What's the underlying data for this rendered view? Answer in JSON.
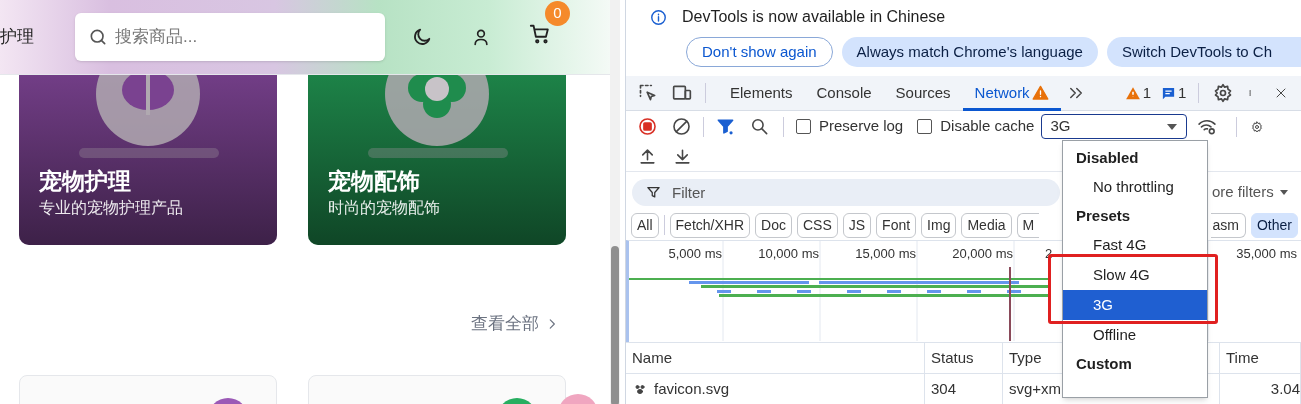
{
  "page": {
    "nav_fragment": "护理",
    "search": {
      "placeholder": "搜索商品..."
    },
    "cart_count": "0",
    "categories": [
      {
        "title": "宠物护理",
        "subtitle": "专业的宠物护理产品",
        "color": "#7a4290"
      },
      {
        "title": "宠物配饰",
        "subtitle": "时尚的宠物配饰",
        "color": "#1f8c4d"
      }
    ],
    "view_all": "查看全部",
    "product_cards": [
      {
        "color": "#9b59b6"
      },
      {
        "color": "#27ae60"
      }
    ]
  },
  "devtools": {
    "infobar": {
      "message": "DevTools is now available in Chinese",
      "buttons": [
        {
          "label": "Don't show again",
          "kind": "outline"
        },
        {
          "label": "Always match Chrome's language",
          "kind": "filled"
        },
        {
          "label": "Switch DevTools to Ch",
          "kind": "filled"
        }
      ]
    },
    "tabs": [
      {
        "label": "Elements",
        "selected": false,
        "warning": false
      },
      {
        "label": "Console",
        "selected": false,
        "warning": false
      },
      {
        "label": "Sources",
        "selected": false,
        "warning": false
      },
      {
        "label": "Network",
        "selected": true,
        "warning": true
      }
    ],
    "issue_counts": {
      "warnings": "1",
      "messages": "1"
    },
    "toolbar": {
      "recording": true,
      "preserve_log": {
        "label": "Preserve log",
        "checked": false
      },
      "disable_cache": {
        "label": "Disable cache",
        "checked": false
      },
      "throttling": "3G"
    },
    "filter": {
      "placeholder": "Filter",
      "more_filters": "ore filters"
    },
    "type_filters": [
      {
        "label": "All",
        "selected": false
      },
      {
        "label": "Fetch/XHR",
        "selected": false
      },
      {
        "label": "Doc",
        "selected": false
      },
      {
        "label": "CSS",
        "selected": false
      },
      {
        "label": "JS",
        "selected": false
      },
      {
        "label": "Font",
        "selected": false
      },
      {
        "label": "Img",
        "selected": false
      },
      {
        "label": "Media",
        "selected": false
      },
      {
        "label": "M",
        "selected": false
      },
      {
        "label": "asm",
        "selected": false
      },
      {
        "label": "Other",
        "selected": true
      }
    ],
    "timeline_ticks": [
      "5,000 ms",
      "10,000 ms",
      "15,000 ms",
      "20,000 ms",
      "2",
      "35,000 ms"
    ],
    "columns": [
      "Name",
      "Status",
      "Type",
      "Time"
    ],
    "rows": [
      {
        "name": "favicon.svg",
        "status": "304",
        "type": "svg+xm",
        "time": "3.04"
      }
    ],
    "throttling_menu": [
      {
        "kind": "header",
        "label": "Disabled"
      },
      {
        "kind": "option",
        "label": "No throttling",
        "selected": false
      },
      {
        "kind": "header",
        "label": "Presets"
      },
      {
        "kind": "option",
        "label": "Fast 4G",
        "selected": false
      },
      {
        "kind": "option",
        "label": "Slow 4G",
        "selected": false,
        "highlighted": true
      },
      {
        "kind": "option",
        "label": "3G",
        "selected": true,
        "highlighted": true
      },
      {
        "kind": "option",
        "label": "Offline",
        "selected": false
      },
      {
        "kind": "header",
        "label": "Custom"
      }
    ]
  }
}
